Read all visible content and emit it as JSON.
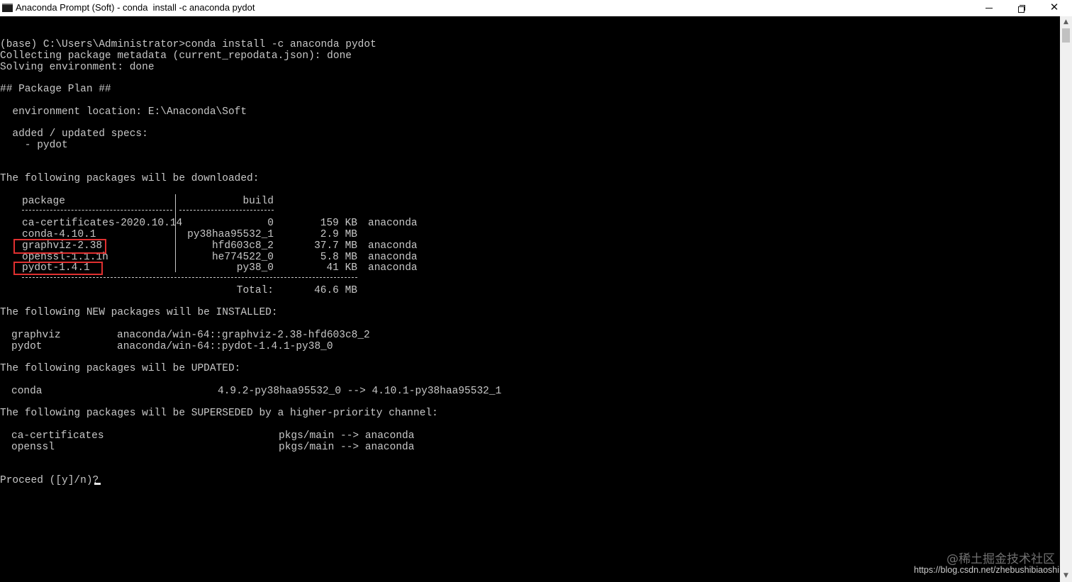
{
  "window": {
    "title": "Anaconda Prompt (Soft) - conda  install -c anaconda pydot",
    "minimize_icon": "minimize-icon",
    "maximize_icon": "restore-icon",
    "close_icon": "close-icon",
    "close_glyph": "✕"
  },
  "terminal": {
    "command_line": "(base) C:\\Users\\Administrator>conda install -c anaconda pydot",
    "collecting": "Collecting package metadata (current_repodata.json): done",
    "solving": "Solving environment: done",
    "package_plan": "## Package Plan ##",
    "env_location": "  environment location: E:\\Anaconda\\Soft",
    "added_specs": "  added / updated specs:",
    "spec_item": "    - pydot",
    "download_header": "The following packages will be downloaded:",
    "table": {
      "col_package": "package",
      "col_build": "build",
      "rows": [
        {
          "package": "ca-certificates-2020.10.14",
          "build": "0",
          "size": "159 KB",
          "channel": "anaconda"
        },
        {
          "package": "conda-4.10.1",
          "build": "py38haa95532_1",
          "size": "2.9 MB",
          "channel": ""
        },
        {
          "package": "graphviz-2.38",
          "build": "hfd603c8_2",
          "size": "37.7 MB",
          "channel": "anaconda"
        },
        {
          "package": "openssl-1.1.1h",
          "build": "he774522_0",
          "size": "5.8 MB",
          "channel": "anaconda"
        },
        {
          "package": "pydot-1.4.1",
          "build": "py38_0",
          "size": "41 KB",
          "channel": "anaconda"
        }
      ],
      "total_label": "Total:",
      "total_value": "46.6 MB"
    },
    "new_header": "The following NEW packages will be INSTALLED:",
    "new_packages": [
      {
        "name": "graphviz",
        "spec": "anaconda/win-64::graphviz-2.38-hfd603c8_2"
      },
      {
        "name": "pydot",
        "spec": "anaconda/win-64::pydot-1.4.1-py38_0"
      }
    ],
    "updated_header": "The following packages will be UPDATED:",
    "updated_packages": [
      {
        "name": "conda",
        "change": "4.9.2-py38haa95532_0 --> 4.10.1-py38haa95532_1"
      }
    ],
    "superseded_header": "The following packages will be SUPERSEDED by a higher-priority channel:",
    "superseded_packages": [
      {
        "name": "ca-certificates",
        "change": "pkgs/main --> anaconda"
      },
      {
        "name": "openssl",
        "change": "pkgs/main --> anaconda"
      }
    ],
    "prompt": "Proceed ([y]/n)?",
    "highlight_color": "#e03030"
  },
  "scrollbar": {
    "up_icon": "scroll-up-arrow-icon",
    "down_icon": "scroll-down-arrow-icon",
    "up_glyph": "▲",
    "down_glyph": "▼"
  },
  "watermark": {
    "line1": "@稀土掘金技术社区",
    "line2": "https://blog.csdn.net/zhebushibiaoshi"
  }
}
